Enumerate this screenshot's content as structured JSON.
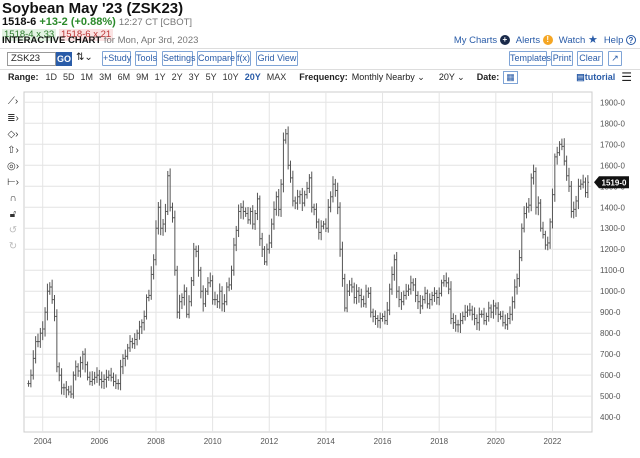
{
  "header": {
    "title": "Soybean May '23 (ZSK23)",
    "last": "1518-6",
    "change": "+13-2 (+0.88%)",
    "time": "12:27 CT [CBOT]",
    "bid": "1518-4 x 33",
    "ask": "1518-6 x 21",
    "chart_label": "INTERACTIVE CHART",
    "chart_date": "for Mon, Apr 3rd, 2023"
  },
  "top_links": {
    "my_charts": "My Charts",
    "alerts": "Alerts",
    "watch": "Watch",
    "help": "Help"
  },
  "toolbar": {
    "symbol": "ZSK23",
    "go": "GO",
    "study": "+Study",
    "tools": "Tools",
    "settings": "Settings",
    "compare": "Compare",
    "fx": "f(x)",
    "grid_view": "Grid View",
    "templates": "Templates",
    "print": "Print",
    "clear": "Clear"
  },
  "range": {
    "label": "Range:",
    "options": [
      "1D",
      "5D",
      "1M",
      "3M",
      "6M",
      "9M",
      "1Y",
      "2Y",
      "3Y",
      "5Y",
      "10Y",
      "20Y",
      "MAX"
    ],
    "active": "20Y",
    "frequency_label": "Frequency:",
    "frequency": "Monthly Nearby",
    "period": "20Y",
    "date_label": "Date:",
    "tutorial": "tutorial"
  },
  "colors": {
    "accent": "#2a5ca8",
    "up": "#2a8a2a",
    "bar": "#555555"
  },
  "chart_data": {
    "type": "ohlc-bar",
    "start": "2003-07",
    "frequency": "monthly",
    "ylim": [
      400,
      1900
    ],
    "y_ticks": [
      "1900-0",
      "1800-0",
      "1700-0",
      "1600-0",
      "1500-0",
      "1400-0",
      "1300-0",
      "1200-0",
      "1100-0",
      "1000-0",
      "900-0",
      "800-0",
      "700-0",
      "600-0",
      "500-0",
      "400-0"
    ],
    "x_ticks": [
      "2004",
      "2006",
      "2008",
      "2010",
      "2012",
      "2014",
      "2016",
      "2018",
      "2020",
      "2022"
    ],
    "last_label": "1519-0",
    "closes": [
      560,
      600,
      680,
      760,
      760,
      800,
      820,
      900,
      1000,
      1020,
      960,
      880,
      640,
      600,
      540,
      540,
      530,
      520,
      510,
      600,
      640,
      620,
      660,
      700,
      650,
      590,
      570,
      580,
      590,
      600,
      580,
      570,
      580,
      590,
      600,
      590,
      570,
      560,
      560,
      640,
      680,
      690,
      730,
      760,
      750,
      770,
      800,
      830,
      850,
      880,
      970,
      980,
      1080,
      1150,
      1300,
      1400,
      1300,
      1320,
      1380,
      1550,
      1400,
      1350,
      1100,
      900,
      950,
      970,
      1000,
      890,
      950,
      1050,
      1200,
      1190,
      1100,
      1000,
      940,
      1000,
      1040,
      1050,
      960,
      960,
      950,
      1000,
      940,
      950,
      1020,
      1030,
      1100,
      1220,
      1290,
      1380,
      1400,
      1380,
      1370,
      1340,
      1380,
      1320,
      1370,
      1440,
      1250,
      1200,
      1140,
      1200,
      1230,
      1320,
      1390,
      1450,
      1390,
      1510,
      1720,
      1750,
      1600,
      1540,
      1430,
      1420,
      1450,
      1460,
      1420,
      1460,
      1490,
      1540,
      1400,
      1390,
      1330,
      1280,
      1310,
      1320,
      1300,
      1400,
      1450,
      1510,
      1480,
      1400,
      1200,
      1060,
      920,
      1000,
      1030,
      1020,
      970,
      1000,
      980,
      960,
      940,
      1000,
      990,
      900,
      880,
      870,
      860,
      870,
      880,
      860,
      910,
      1010,
      1080,
      1150,
      1000,
      960,
      950,
      980,
      1000,
      1010,
      1040,
      1030,
      980,
      950,
      930,
      960,
      990,
      940,
      960,
      980,
      990,
      970,
      990,
      1040,
      1050,
      1040,
      1010,
      870,
      850,
      840,
      840,
      860,
      880,
      900,
      910,
      910,
      890,
      870,
      850,
      890,
      890,
      860,
      880,
      920,
      900,
      930,
      920,
      890,
      880,
      850,
      840,
      870,
      890,
      950,
      1020,
      1060,
      1160,
      1300,
      1370,
      1400,
      1410,
      1540,
      1570,
      1400,
      1420,
      1300,
      1270,
      1220,
      1230,
      1330,
      1460,
      1640,
      1660,
      1700,
      1690,
      1620,
      1550,
      1500,
      1380,
      1390,
      1430,
      1500,
      1510,
      1520,
      1470,
      1519
    ]
  }
}
